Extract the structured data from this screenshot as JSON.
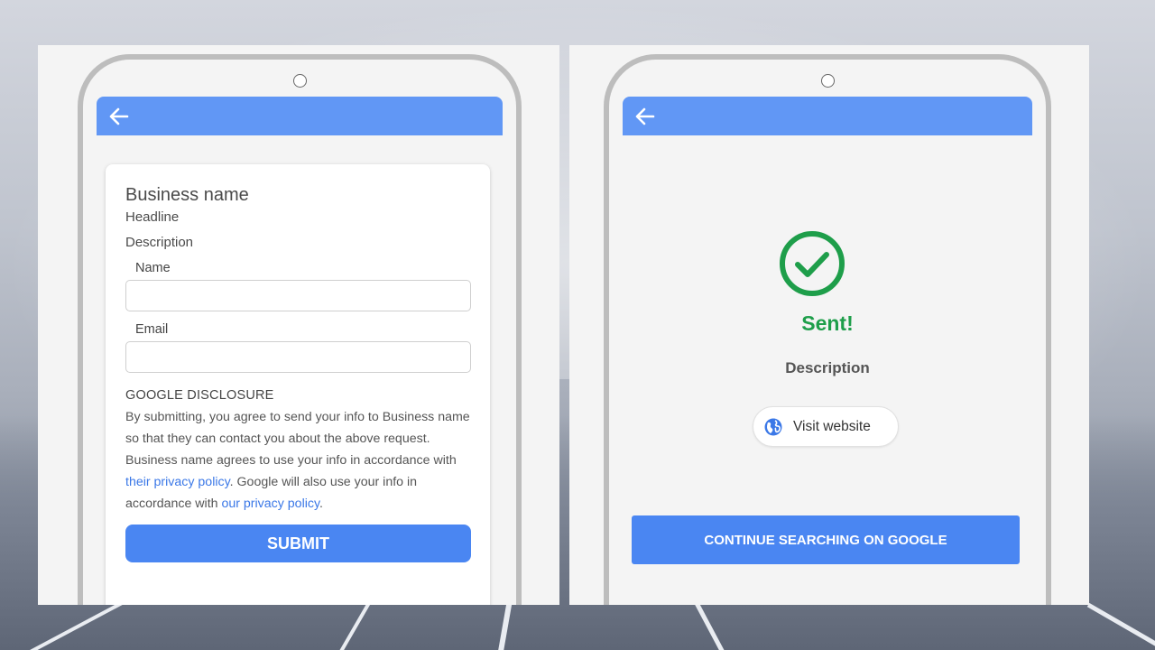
{
  "left_screen": {
    "business_name": "Business name",
    "headline": "Headline",
    "description": "Description",
    "name_label": "Name",
    "name_value": "",
    "email_label": "Email",
    "email_value": "",
    "disclosure_title": "GOOGLE DISCLOSURE",
    "disclosure_part1": "By submitting, you agree to send your info to Business name so that they can contact you about the above request. Business name agrees to use your info in accordance with ",
    "disclosure_link1": "their privacy policy",
    "disclosure_part2": ". Google will also use your info in accordance with ",
    "disclosure_link2": "our privacy policy",
    "disclosure_part3": ".",
    "submit_label": "SUBMIT"
  },
  "right_screen": {
    "sent_title": "Sent!",
    "description": "Description",
    "visit_website_label": "Visit website",
    "continue_label": "CONTINUE SEARCHING ON GOOGLE"
  },
  "colors": {
    "appbar": "#6197f5",
    "primary_button": "#4a86f2",
    "success": "#1e9e4a",
    "link": "#3b78e7"
  },
  "icons": {
    "back": "arrow-left-icon",
    "success": "check-circle-icon",
    "website": "globe-icon"
  }
}
